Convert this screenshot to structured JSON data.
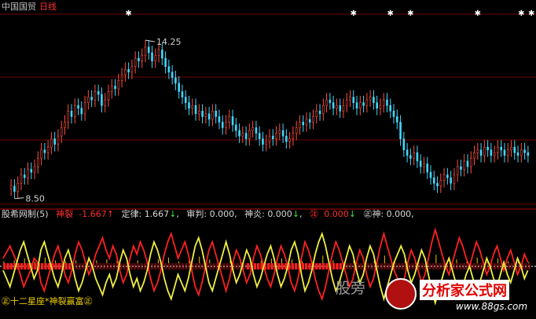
{
  "header": {
    "stock_name": "中国国贸",
    "period": "日线"
  },
  "indicator": {
    "name": "股希网制(5)",
    "values": [
      {
        "label": "神裂",
        "value": "-1.667",
        "arrow": "↑",
        "color": "#ff3030"
      },
      {
        "label": "定律",
        "value": "1.667",
        "arrow": "↓",
        "color": "#d8d8d8"
      },
      {
        "label": "审判",
        "value": "0.000",
        "arrow": "",
        "color": "#d8d8d8"
      },
      {
        "label": "神炎",
        "value": "0.000",
        "arrow": "↓",
        "color": "#d8d8d8"
      },
      {
        "label": "㊟",
        "value": "0.000",
        "arrow": "↓",
        "color": "#ff3030"
      },
      {
        "label": "㊣神",
        "value": "0.000",
        "arrow": "",
        "color": "#d8d8d8"
      }
    ],
    "footer": "㊣十二星座*神裂赢富㊣"
  },
  "watermark": {
    "text": "股旁",
    "brand": "分析家公式网",
    "url": "www.88gs.com"
  },
  "chart_data": [
    {
      "type": "candlestick",
      "high_label": "14.25",
      "low_label": "8.50",
      "ylim": [
        8.3,
        15.2
      ],
      "grid": "horizontal-dotted",
      "marker_bars": [
        35,
        102,
        113,
        119,
        139,
        152,
        155
      ],
      "close": [
        8.9,
        8.7,
        9.0,
        9.3,
        9.2,
        9.5,
        9.4,
        9.6,
        9.9,
        10.2,
        10.1,
        10.3,
        10.6,
        10.4,
        10.7,
        11.0,
        11.2,
        11.6,
        11.4,
        11.8,
        11.7,
        11.5,
        11.9,
        12.1,
        12.0,
        12.3,
        12.2,
        11.8,
        12.0,
        12.3,
        12.5,
        12.4,
        12.7,
        12.9,
        13.1,
        13.0,
        13.2,
        13.5,
        13.4,
        13.6,
        13.9,
        13.7,
        13.4,
        13.6,
        13.8,
        13.5,
        13.2,
        13.0,
        12.8,
        12.6,
        12.3,
        12.1,
        11.9,
        11.7,
        11.8,
        11.5,
        11.6,
        11.4,
        11.5,
        11.3,
        11.6,
        11.4,
        11.2,
        11.0,
        11.2,
        11.4,
        11.1,
        10.9,
        10.7,
        10.8,
        10.6,
        10.9,
        11.0,
        10.8,
        10.6,
        10.4,
        10.5,
        10.7,
        10.6,
        10.8,
        10.9,
        10.7,
        10.5,
        10.6,
        10.8,
        11.0,
        11.2,
        11.1,
        11.3,
        11.2,
        11.4,
        11.6,
        11.5,
        11.8,
        12.0,
        11.9,
        11.7,
        11.8,
        11.6,
        11.8,
        12.0,
        12.1,
        11.9,
        11.7,
        11.9,
        11.8,
        12.0,
        12.1,
        11.9,
        11.7,
        11.8,
        12.0,
        11.8,
        11.6,
        11.4,
        11.2,
        10.6,
        10.2,
        10.0,
        9.9,
        10.1,
        9.8,
        9.6,
        9.7,
        9.4,
        9.2,
        9.0,
        8.9,
        9.1,
        9.3,
        9.2,
        9.0,
        9.3,
        9.6,
        9.5,
        9.8,
        9.6,
        9.9,
        10.1,
        10.2,
        10.0,
        10.3,
        10.2,
        10.0,
        10.1,
        10.3,
        10.2,
        10.0,
        10.2,
        10.3,
        10.1,
        10.0,
        10.2,
        10.1,
        10.0
      ]
    },
    {
      "type": "line",
      "series": [
        {
          "color": "#ff2020",
          "values": [
            0.2,
            0.35,
            0.5,
            0.3,
            0.1,
            -0.2,
            -0.5,
            -0.3,
            -0.1,
            0.2,
            0.1,
            -0.4,
            -0.6,
            -0.3,
            0.0,
            0.3,
            0.5,
            0.2,
            -0.2,
            -0.4,
            -0.1,
            0.3,
            0.6,
            0.4,
            0.1,
            -0.2,
            0.0,
            0.3,
            0.5,
            0.7,
            0.4,
            0.2,
            0.5,
            0.3,
            -0.1,
            -0.4,
            -0.2,
            0.2,
            0.5,
            0.3,
            0.6,
            0.4,
            0.1,
            -0.3,
            -0.6,
            -0.4,
            -0.1,
            0.3,
            0.6,
            0.8,
            0.5,
            0.2,
            0.4,
            0.6,
            0.3,
            -0.1,
            -0.5,
            -0.7,
            -0.4,
            0.0,
            0.4,
            0.6,
            0.3,
            0.0,
            -0.3,
            -0.6,
            -0.3,
            0.1,
            0.4,
            0.2,
            -0.1,
            -0.4,
            -0.2,
            0.2,
            0.5,
            0.3,
            0.0,
            -0.3,
            -0.5,
            -0.2,
            0.2,
            0.5,
            0.3,
            0.0,
            -0.4,
            -0.6,
            -0.3,
            0.2,
            0.6,
            0.4,
            0.1,
            -0.3,
            -0.6,
            -0.8,
            -0.5,
            -0.1,
            0.3,
            0.6,
            0.4,
            0.1,
            -0.2,
            -0.5,
            -0.3,
            0.1,
            0.4,
            0.2,
            -0.2,
            -0.5,
            -0.3,
            0.1,
            0.5,
            0.8,
            0.5,
            0.2,
            -0.1,
            -0.3,
            -0.5,
            -0.3,
            0.1,
            0.4,
            0.2,
            -0.1,
            -0.4,
            -0.2,
            0.2,
            0.6,
            0.9,
            0.6,
            0.3,
            0.0,
            -0.2,
            0.1,
            0.4,
            0.7,
            0.5,
            0.2,
            0.0,
            0.3,
            0.6,
            0.4,
            0.1,
            -0.2,
            0.0,
            0.3,
            0.5,
            0.2,
            -0.1,
            0.2,
            0.4,
            0.1,
            -0.2,
            0.0,
            0.3,
            0.1
          ]
        },
        {
          "color": "#f0f040",
          "values": [
            -0.1,
            -0.3,
            -0.5,
            -0.2,
            0.1,
            0.4,
            0.6,
            0.3,
            0.0,
            -0.3,
            -0.1,
            0.4,
            0.6,
            0.3,
            0.0,
            -0.3,
            -0.5,
            -0.2,
            0.2,
            0.4,
            0.1,
            -0.3,
            -0.6,
            -0.4,
            -0.1,
            0.2,
            0.0,
            -0.3,
            -0.5,
            -0.7,
            -0.4,
            -0.2,
            -0.5,
            -0.3,
            0.1,
            0.4,
            0.2,
            -0.2,
            -0.5,
            -0.3,
            -0.6,
            -0.4,
            -0.1,
            0.3,
            0.6,
            0.4,
            0.1,
            -0.3,
            -0.6,
            -0.8,
            -0.5,
            -0.2,
            -0.4,
            -0.6,
            -0.3,
            0.1,
            0.5,
            0.7,
            0.4,
            0.0,
            -0.4,
            -0.6,
            -0.3,
            0.0,
            0.3,
            0.6,
            0.3,
            -0.1,
            -0.4,
            -0.2,
            0.1,
            0.4,
            0.2,
            -0.2,
            -0.5,
            -0.3,
            0.0,
            0.3,
            0.5,
            0.2,
            -0.2,
            -0.5,
            -0.3,
            0.0,
            0.4,
            0.6,
            0.3,
            -0.2,
            -0.6,
            -0.4,
            -0.1,
            0.3,
            0.6,
            0.8,
            0.5,
            0.1,
            -0.3,
            -0.6,
            -0.4,
            -0.1,
            0.2,
            0.5,
            0.3,
            -0.1,
            -0.4,
            -0.2,
            0.2,
            0.5,
            0.3,
            -0.1,
            -0.5,
            -0.8,
            -0.5,
            -0.2,
            0.1,
            0.3,
            0.5,
            0.3,
            -0.1,
            -0.4,
            -0.2,
            0.1,
            0.4,
            0.2,
            -0.2,
            -0.6,
            -0.9,
            -0.6,
            -0.3,
            0.0,
            0.2,
            -0.1,
            -0.4,
            -0.7,
            -0.5,
            -0.2,
            0.0,
            -0.3,
            -0.6,
            -0.4,
            -0.1,
            0.2,
            0.0,
            -0.3,
            -0.5,
            -0.2,
            0.1,
            -0.2,
            -0.4,
            -0.1,
            0.2,
            0.0,
            -0.3,
            -0.1
          ]
        }
      ]
    }
  ]
}
